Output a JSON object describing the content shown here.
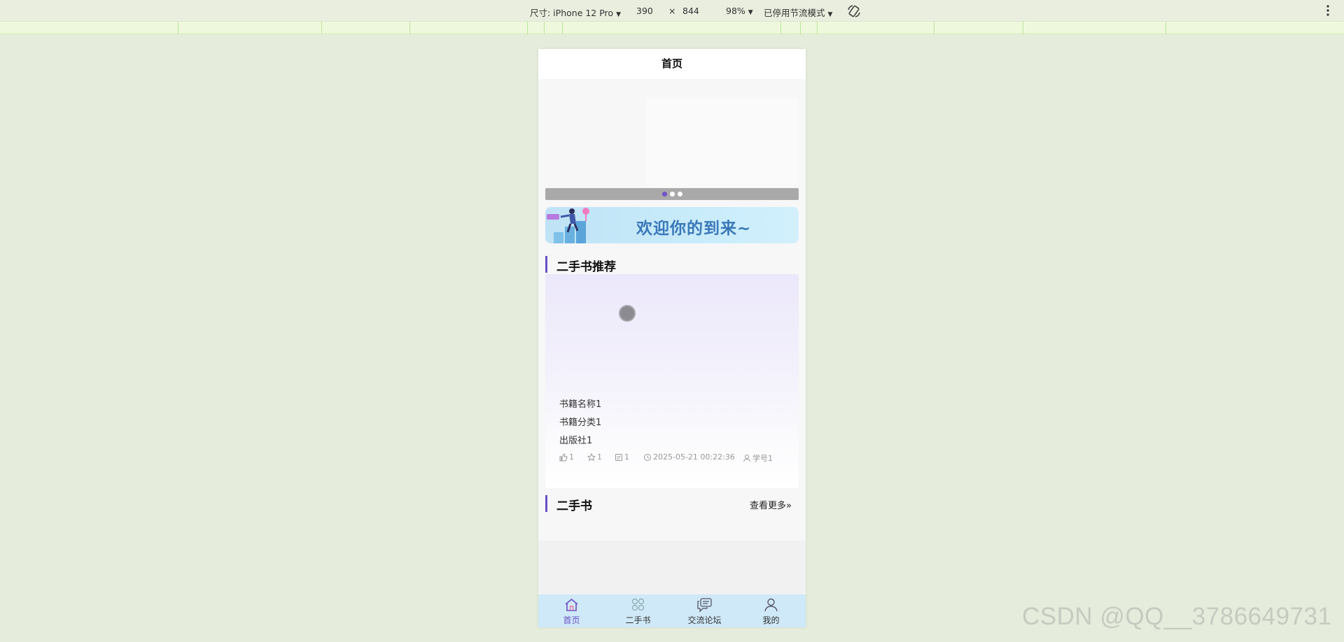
{
  "devtools": {
    "device_label": "尺寸: iPhone 12 Pro",
    "width": "390",
    "times": "×",
    "height": "844",
    "zoom": "98%",
    "throttle": "已停用节流模式"
  },
  "app": {
    "page_title": "首页",
    "swiper": {
      "slide_count": 3,
      "active_index": 0
    },
    "banner": {
      "text": "欢迎你的到来~"
    },
    "recommend": {
      "title": "二手书推荐",
      "book": {
        "name": "书籍名称1",
        "category": "书籍分类1",
        "publisher": "出版社1",
        "likes": "1",
        "favorites": "1",
        "comments": "1",
        "time": "2025-05-21 00:22:36",
        "author": "学号1"
      }
    },
    "secondhand": {
      "title": "二手书",
      "more": "查看更多"
    },
    "tabbar": [
      {
        "label": "首页",
        "icon": "home-icon",
        "active": true
      },
      {
        "label": "二手书",
        "icon": "grid-icon",
        "active": false
      },
      {
        "label": "交流论坛",
        "icon": "chat-icon",
        "active": false
      },
      {
        "label": "我的",
        "icon": "user-icon",
        "active": false
      }
    ]
  },
  "watermark": "CSDN @QQ__3786649731",
  "colors": {
    "accent": "#6a4fc7",
    "tabbar_bg": "#cfe9f8",
    "banner_text": "#3a78b9",
    "page_bg": "#e6ecdb"
  }
}
